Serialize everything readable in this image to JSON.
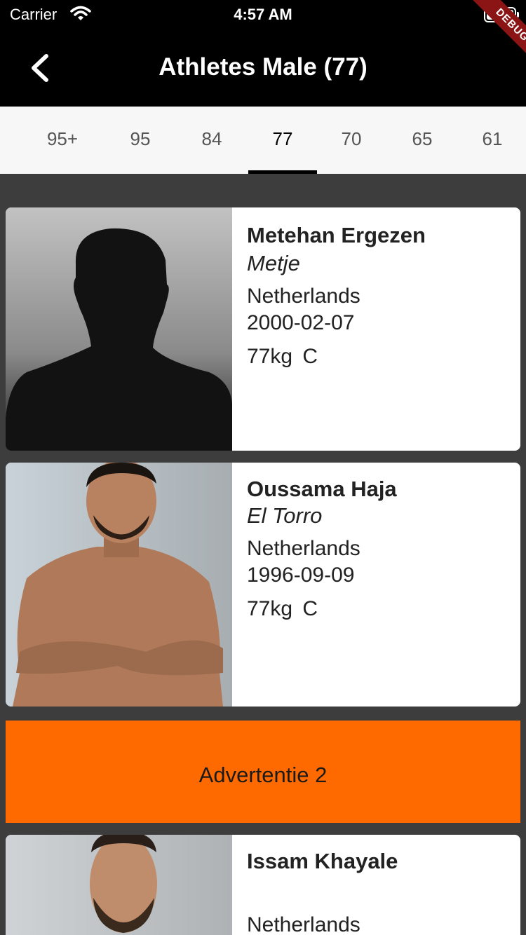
{
  "status": {
    "carrier": "Carrier",
    "time": "4:57 AM",
    "debug": "DEBUG"
  },
  "header": {
    "title": "Athletes Male (77)",
    "back_icon": "chevron-left-icon"
  },
  "tabs": [
    {
      "label": "95+",
      "active": false
    },
    {
      "label": "95",
      "active": false
    },
    {
      "label": "84",
      "active": false
    },
    {
      "label": "77",
      "active": true
    },
    {
      "label": "70",
      "active": false
    },
    {
      "label": "65",
      "active": false
    },
    {
      "label": "61",
      "active": false
    }
  ],
  "athletes": [
    {
      "name": "Metehan Ergezen",
      "nickname": "Metje",
      "country": "Netherlands",
      "dob": "2000-02-07",
      "weight": "77kg  C"
    },
    {
      "name": "Oussama Haja",
      "nickname": "El Torro",
      "country": "Netherlands",
      "dob": "1996-09-09",
      "weight": "77kg  C"
    },
    {
      "name": "Issam Khayale",
      "nickname": "",
      "country": "Netherlands",
      "dob": "",
      "weight": ""
    }
  ],
  "ad": {
    "label": "Advertentie 2"
  },
  "colors": {
    "appbar": "#000000",
    "ad": "#ff6a00",
    "background": "#3d3d3d",
    "debug_banner": "#8b1414"
  }
}
